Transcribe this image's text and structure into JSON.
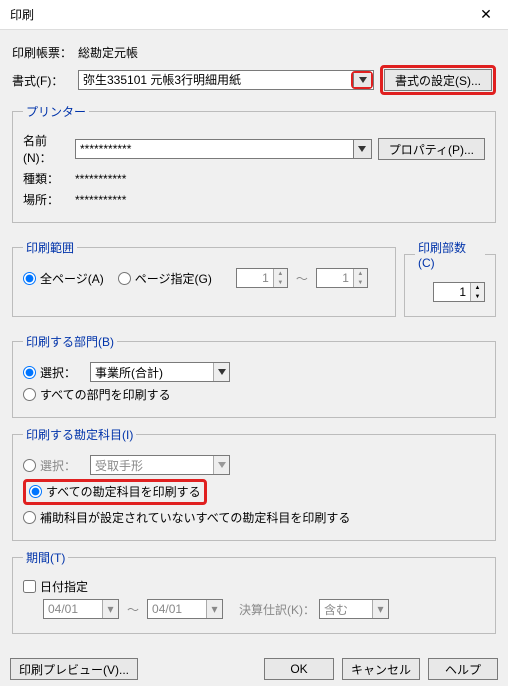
{
  "title": "印刷",
  "close_glyph": "✕",
  "sec1": {
    "form_label": "印刷帳票：",
    "form_value": "総勘定元帳",
    "format_label": "書式(F)：",
    "format_value": "弥生335101 元帳3行明細用紙",
    "format_settings_btn": "書式の設定(S)..."
  },
  "printer": {
    "legend": "プリンター",
    "name_label": "名前(N)：",
    "name_value": "***********",
    "properties_btn": "プロパティ(P)...",
    "type_label": "種類：",
    "type_value": "***********",
    "location_label": "場所：",
    "location_value": "***********"
  },
  "range": {
    "legend": "印刷範囲",
    "all_pages": "全ページ(A)",
    "page_spec": "ページ指定(G)",
    "from": "1",
    "to": "1",
    "tilde": "～"
  },
  "copies": {
    "legend": "印刷部数(C)",
    "value": "1"
  },
  "dept": {
    "legend": "印刷する部門(B)",
    "select": "選択：",
    "value": "事業所(合計)",
    "all": "すべての部門を印刷する"
  },
  "account": {
    "legend": "印刷する勘定科目(I)",
    "select": "選択：",
    "value": "受取手形",
    "all": "すべての勘定科目を印刷する",
    "aux": "補助科目が設定されていないすべての勘定科目を印刷する"
  },
  "period": {
    "legend": "期間(T)",
    "date_spec": "日付指定",
    "from": "04/01",
    "to": "04/01",
    "tilde": "～",
    "closing_label": "決算仕訳(K)：",
    "closing_value": "含む"
  },
  "footer": {
    "preview": "印刷プレビュー(V)...",
    "ok": "OK",
    "cancel": "キャンセル",
    "help": "ヘルプ"
  }
}
